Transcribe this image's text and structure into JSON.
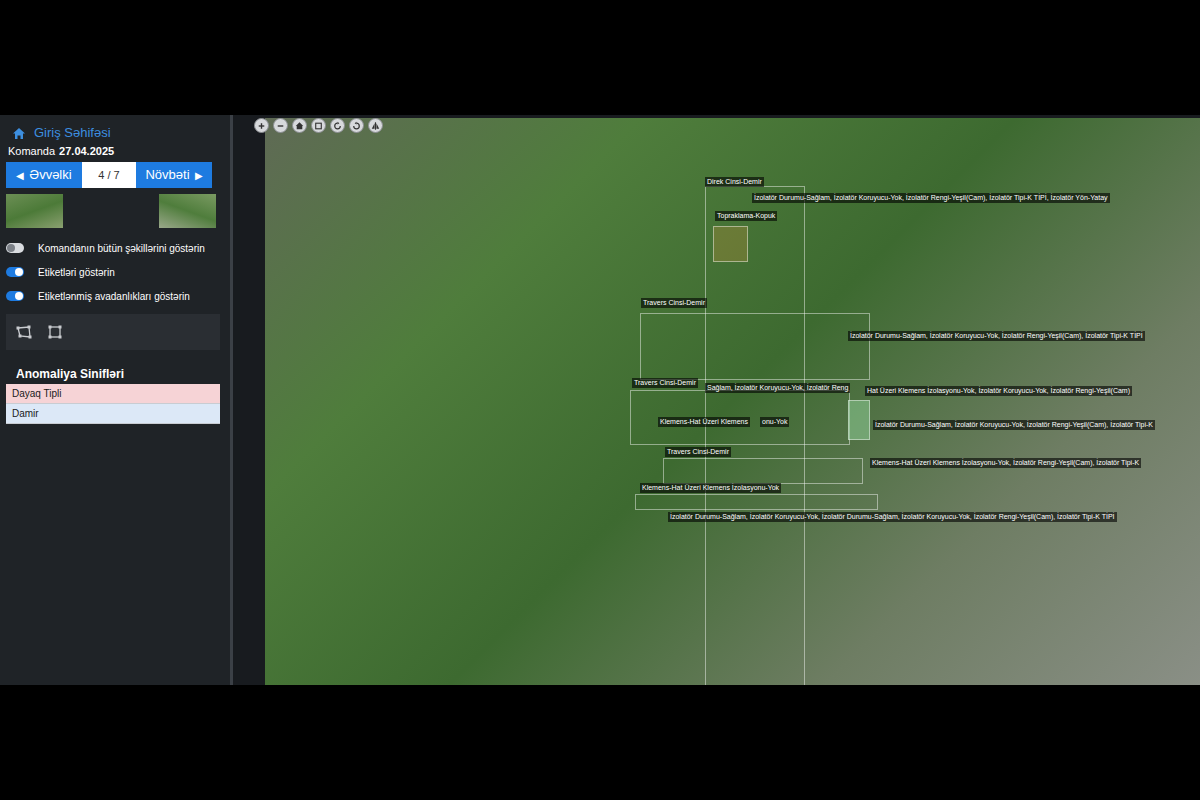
{
  "sidebar": {
    "home_link": "Giriş Səhifəsi",
    "team_label": "Komanda",
    "date": "27.04.2025",
    "prev_icon": "◀",
    "prev": "Əvvəlki",
    "counter": "4 / 7",
    "next": "Növbəti",
    "next_icon": "▶",
    "toggles": [
      {
        "label": "Komandanın bütün şəkillərini göstərin",
        "on": false
      },
      {
        "label": "Etiketləri göstərin",
        "on": true
      },
      {
        "label": "Etiketlənmiş avadanlıkları göstərin",
        "on": true
      }
    ],
    "anomaly_title": "Anomaliya Sinifləri",
    "anomaly_classes": [
      {
        "label": "Dayaq Tipli",
        "color": "#f6d3d6"
      },
      {
        "label": "Damir",
        "color": "#dce8f7"
      }
    ]
  },
  "annotations": [
    {
      "label": "Direk Cinsi-Demir"
    },
    {
      "label": "İzolatör Durumu-Sağlam, İzolatör Koruyucu-Yok, İzolatör Rengi-Yeşil(Cam), İzolatör Tipi-K TİPİ, İzolatör Yön-Yatay"
    },
    {
      "label": "Topraklama-Kopuk"
    },
    {
      "label": "Travers Cinsi-Demir"
    },
    {
      "label": "İzolatör Durumu-Sağlam, İzolatör Koruyucu-Yok, İzolatör Rengi-Yeşil(Cam), İzolatör Tipi-K TİPİ"
    },
    {
      "label": "Travers Cinsi-Demir"
    },
    {
      "label": "Sağlam, İzolatör Koruyucu-Yok, İzolatör Reng"
    },
    {
      "label": "Hat Üzeri Klemens İzolasyonu-Yok, İzolatör Koruyucu-Yok, İzolatör Rengi-Yeşil(Cam)"
    },
    {
      "label": "Klemens-Hat Üzeri Klemens"
    },
    {
      "label": "onu-Yok"
    },
    {
      "label": "İzolatör Durumu-Sağlam, İzolatör Koruyucu-Yok, İzolatör Rengi-Yeşil(Cam), İzolatör Tipi-K"
    },
    {
      "label": "Travers Cinsi-Demir"
    },
    {
      "label": "Klemens-Hat Üzeri Klemens İzolasyonu-Yok, İzolatör Rengi-Yeşil(Cam), İzolatör Tipi-K"
    },
    {
      "label": "Klemens-Hat Üzeri Klemens İzolasyonu-Yok"
    },
    {
      "label": "İzolatör Durumu-Sağlam, İzolatör Koruyucu-Yok, İzolatör Durumu-Sağlam, İzolatör Koruyucu-Yok, İzolatör Rengi-Yeşil(Cam), İzolatör Tipi-K TİPİ"
    }
  ]
}
